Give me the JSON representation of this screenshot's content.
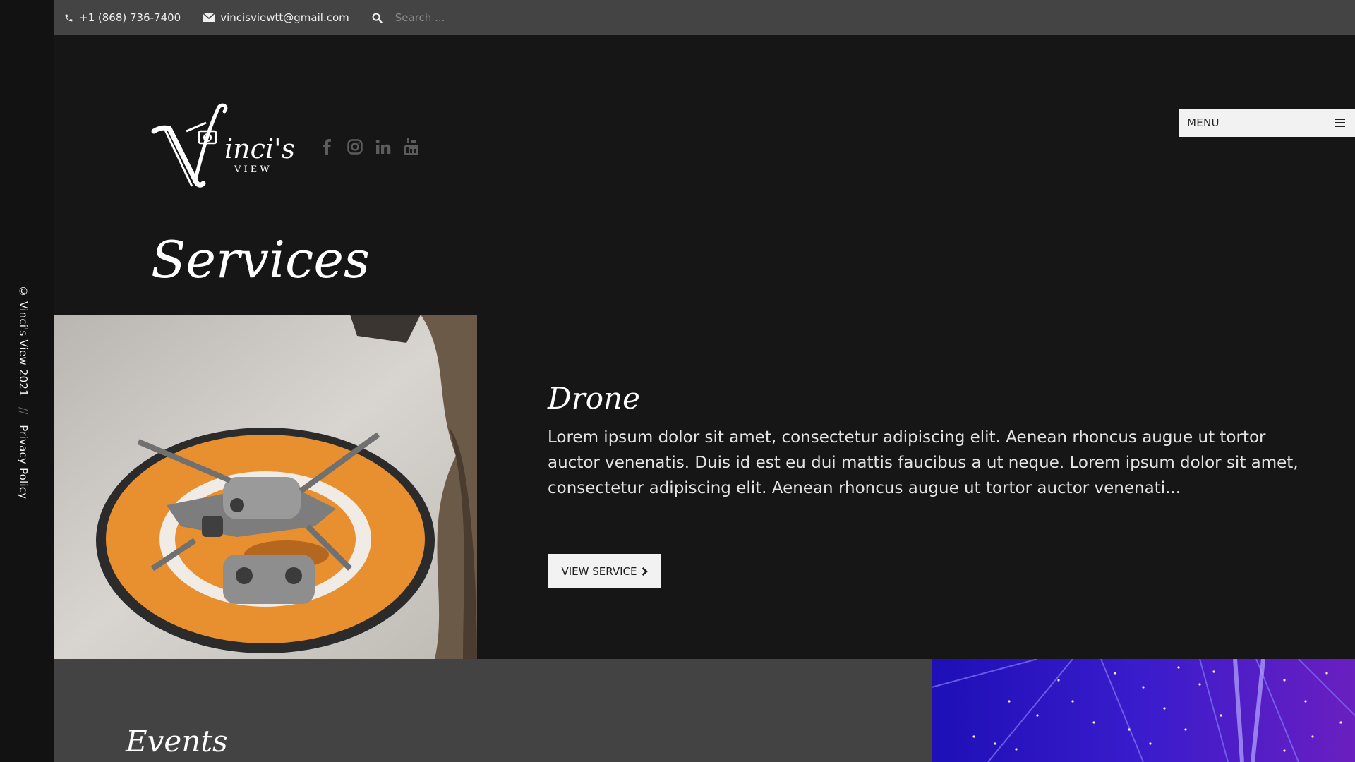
{
  "topbar": {
    "phone": "+1 (868) 736-7400",
    "email": "vincisviewtt@gmail.com",
    "search_placeholder": "Search ..."
  },
  "brand": {
    "logo_main": "inci's",
    "logo_sub": "V I E W"
  },
  "socials": [
    {
      "name": "facebook-icon"
    },
    {
      "name": "instagram-icon"
    },
    {
      "name": "linkedin-icon"
    },
    {
      "name": "youtube-icon"
    }
  ],
  "menu": {
    "label": "MENU"
  },
  "page": {
    "title": "Services"
  },
  "services": {
    "drone": {
      "title": "Drone",
      "description": "Lorem ipsum dolor sit amet, consectetur adipiscing elit. Aenean rhoncus augue ut tortor auctor venenatis. Duis id est eu dui mattis faucibus a ut neque. Lorem ipsum dolor sit amet, consectetur adipiscing elit. Aenean rhoncus augue ut tortor auctor venenati...",
      "button": "VIEW SERVICE"
    },
    "events": {
      "title": "Events"
    }
  },
  "sidebar": {
    "copyright": "© Vinci's View 2021",
    "separator": "//",
    "privacy": "Privacy Policy"
  },
  "colors": {
    "background": "#161616",
    "topbar": "#444444",
    "panel": "#434343",
    "button": "#f2f2f2"
  }
}
